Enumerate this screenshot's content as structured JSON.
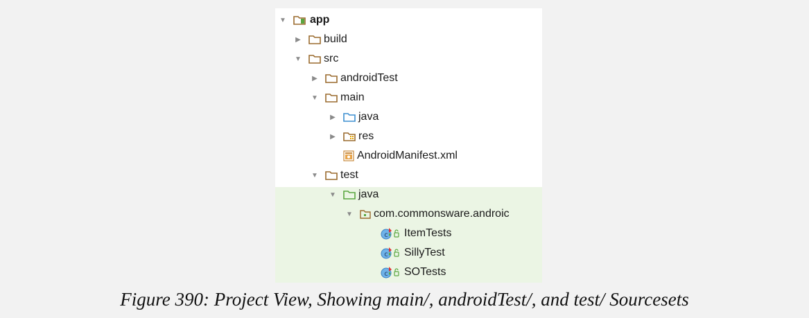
{
  "tree": {
    "items": [
      {
        "label": "app",
        "expanded": true,
        "icon": "module-folder-icon"
      },
      {
        "label": "build",
        "expanded": false,
        "icon": "folder-icon"
      },
      {
        "label": "src",
        "expanded": true,
        "icon": "folder-icon"
      },
      {
        "label": "androidTest",
        "expanded": false,
        "icon": "folder-icon"
      },
      {
        "label": "main",
        "expanded": true,
        "icon": "folder-icon"
      },
      {
        "label": "java",
        "expanded": false,
        "icon": "source-folder-icon"
      },
      {
        "label": "res",
        "expanded": false,
        "icon": "resource-folder-icon"
      },
      {
        "label": "AndroidManifest.xml",
        "icon": "manifest-file-icon"
      },
      {
        "label": "test",
        "expanded": true,
        "icon": "folder-icon"
      },
      {
        "label": "java",
        "expanded": true,
        "icon": "test-source-folder-icon"
      },
      {
        "label": "com.commonsware.androic",
        "expanded": true,
        "icon": "package-icon"
      },
      {
        "label": "ItemTests",
        "icon": "test-class-icon"
      },
      {
        "label": "SillyTest",
        "icon": "test-class-icon"
      },
      {
        "label": "SOTests",
        "icon": "test-class-icon"
      }
    ]
  },
  "colors": {
    "folder": "#9a6a2d",
    "source_folder": "#3d8fd0",
    "test_folder": "#5aa640",
    "selection_highlight": "#ebf5e4"
  },
  "caption": "Figure 390: Project View, Showing main/, androidTest/, and test/ Sourcesets"
}
